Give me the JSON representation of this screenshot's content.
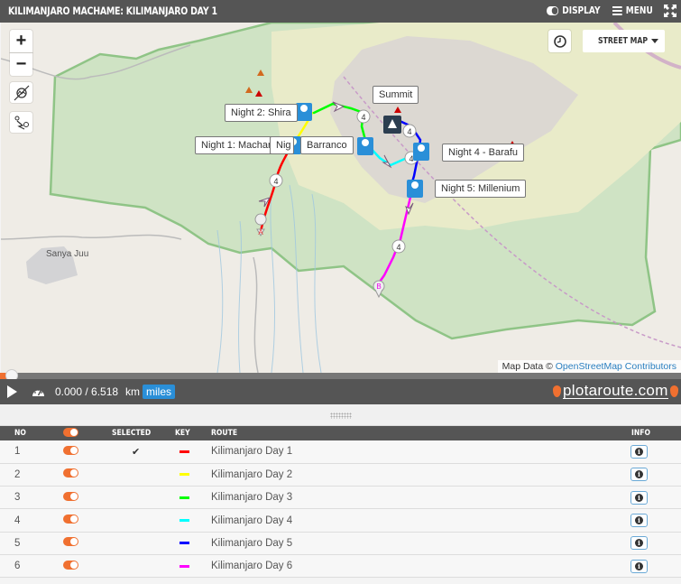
{
  "header": {
    "title": "KILIMANJARO MACHAME: KILIMANJARO DAY 1",
    "display_label": "DISPLAY",
    "menu_label": "MENU"
  },
  "map": {
    "zoom_in": "+",
    "zoom_out": "−",
    "map_type": "STREET MAP",
    "attribution_prefix": "Map Data ©",
    "attribution_link": "OpenStreetMap Contributors",
    "place_labels": [
      "Sanya Juu"
    ],
    "camp_labels": [
      "Night 1: Machame",
      "Night 2: Shira",
      "Night 3: Barranco",
      "Summit",
      "Night 4 - Barafu",
      "Night 5: Millenium"
    ],
    "visible_labels": {
      "night1": "Night 1: Machame",
      "night2": "Night 2: Shira",
      "night3_part": "Nig",
      "night3": "Barranco",
      "summit": "Summit",
      "night4": "Night 4 - Barafu",
      "night5": "Night 5: Millenium"
    },
    "distance_marker": "4",
    "start_marker": "A",
    "end_marker": "B"
  },
  "playback": {
    "progress_fraction": 0.0,
    "distance": "0.000 / 6.518",
    "unit_km": "km",
    "unit_miles": "miles",
    "selected_unit": "miles",
    "brand": "plotaroute.com"
  },
  "table": {
    "headers": {
      "no": "NO",
      "selected": "SELECTED",
      "key": "KEY",
      "route": "ROUTE",
      "info": "INFO"
    },
    "rows": [
      {
        "no": "1",
        "enabled": true,
        "selected": "✔",
        "color": "#ff0000",
        "route": "Kilimanjaro Day 1"
      },
      {
        "no": "2",
        "enabled": true,
        "selected": "",
        "color": "#ffff00",
        "route": "Kilimanjaro Day 2"
      },
      {
        "no": "3",
        "enabled": true,
        "selected": "",
        "color": "#00ff00",
        "route": "Kilimanjaro Day 3"
      },
      {
        "no": "4",
        "enabled": true,
        "selected": "",
        "color": "#00ffff",
        "route": "Kilimanjaro Day 4"
      },
      {
        "no": "5",
        "enabled": true,
        "selected": "",
        "color": "#0000ff",
        "route": "Kilimanjaro Day 5"
      },
      {
        "no": "6",
        "enabled": true,
        "selected": "",
        "color": "#ff00ff",
        "route": "Kilimanjaro Day 6"
      }
    ]
  },
  "colors": {
    "accent": "#f07030",
    "bar": "#555555",
    "link": "#2a8fd8"
  }
}
